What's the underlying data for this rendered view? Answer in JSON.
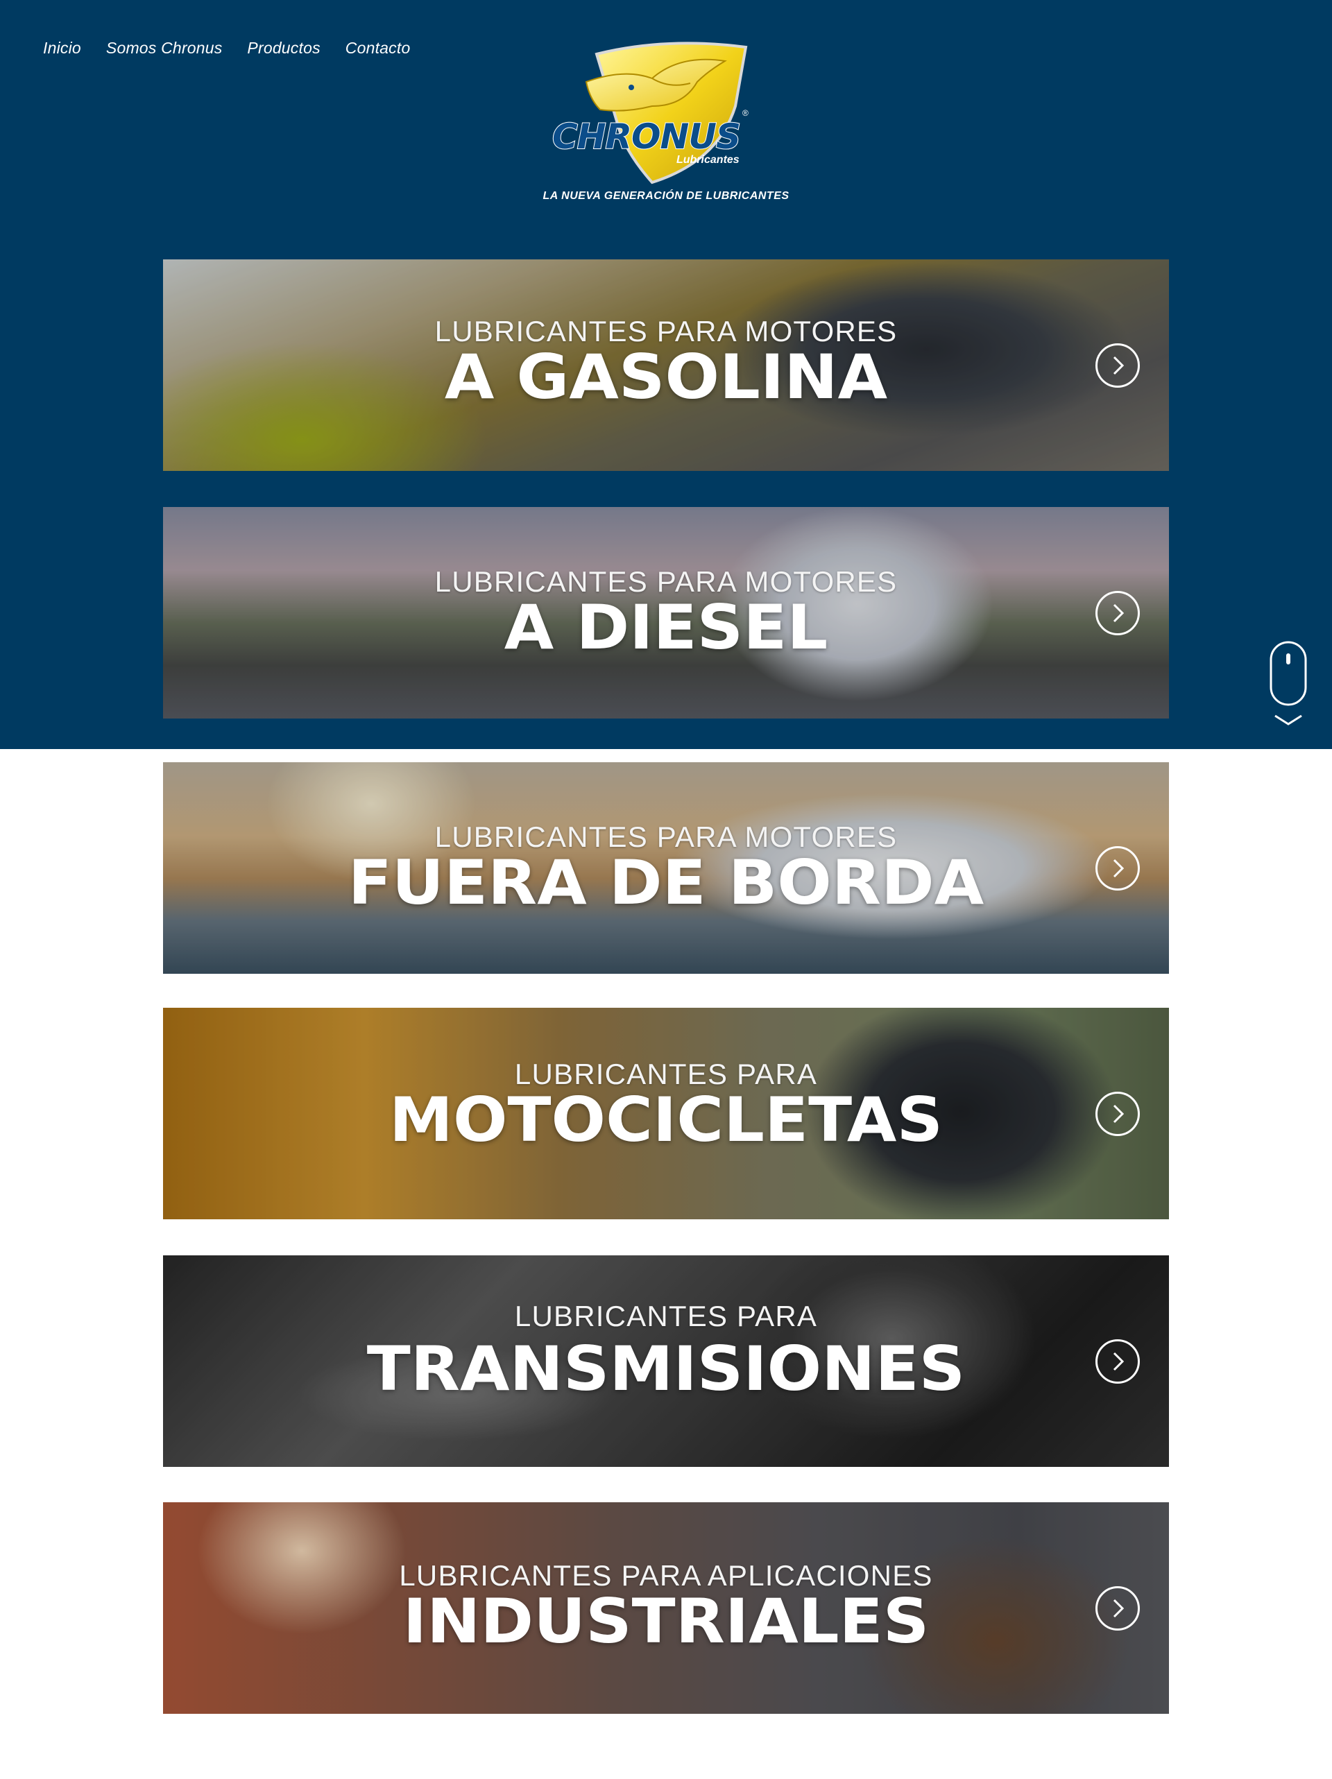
{
  "nav": {
    "items": [
      "Inicio",
      "Somos Chronus",
      "Productos",
      "Contacto"
    ]
  },
  "logo": {
    "brand": "CHRONUS",
    "sub": "Lubricantes",
    "registered": "®"
  },
  "tagline": "LA NUEVA GENERACIÓN DE LUBRICANTES",
  "banners": [
    {
      "pre": "LUBRICANTES PARA MOTORES",
      "main": "A GASOLINA"
    },
    {
      "pre": "LUBRICANTES PARA MOTORES",
      "main": "A DIESEL"
    },
    {
      "pre": "LUBRICANTES PARA MOTORES",
      "main": "FUERA DE BORDA"
    },
    {
      "pre": "LUBRICANTES PARA",
      "main": "MOTOCICLETAS"
    },
    {
      "pre": "LUBRICANTES PARA",
      "main": "TRANSMISIONES"
    },
    {
      "pre": "LUBRICANTES PARA APLICACIONES",
      "main": "INDUSTRIALES"
    }
  ],
  "colors": {
    "brand_navy": "#003a61",
    "logo_yellow": "#f2d21a",
    "logo_blue": "#0b4d8a"
  },
  "icons": {
    "banner_arrow": "chevron-right-circle-icon",
    "scroll": "mouse-scroll-icon"
  }
}
